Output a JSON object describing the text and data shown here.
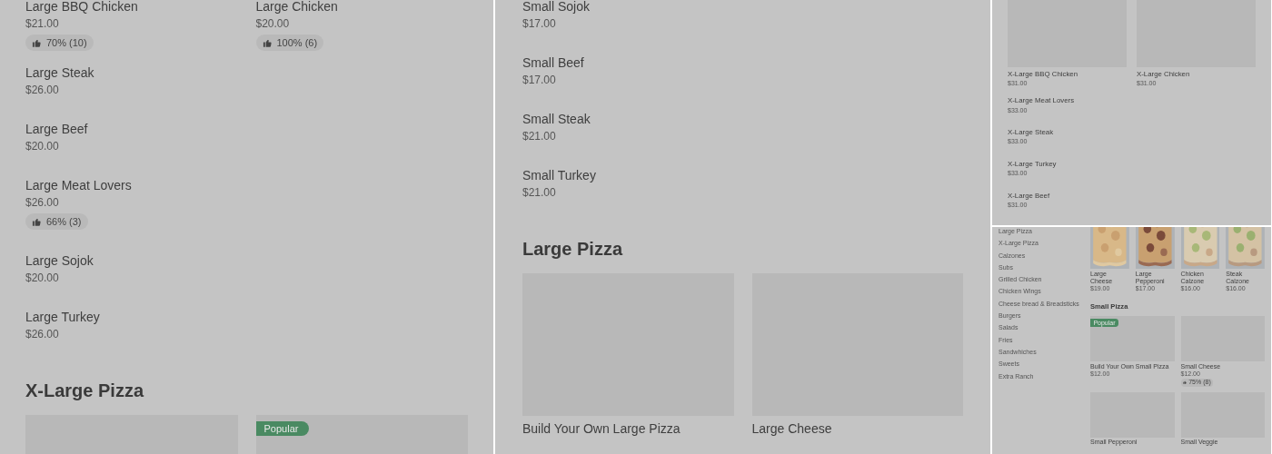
{
  "panels": [
    {
      "blocks": [
        {
          "kind": "text_cards",
          "cards": [
            {
              "name": "Large BBQ Chicken",
              "price": "$21.00",
              "rating": "70% (10)"
            },
            {
              "name": "Large Chicken",
              "price": "$20.00",
              "rating": "100% (6)"
            }
          ]
        },
        {
          "kind": "item",
          "name": "Large Steak",
          "price": "$26.00"
        },
        {
          "kind": "item",
          "name": "Large Beef",
          "price": "$20.00"
        },
        {
          "kind": "item",
          "name": "Large Meat Lovers",
          "price": "$26.00",
          "rating": "66% (3)"
        },
        {
          "kind": "item",
          "name": "Large Sojok",
          "price": "$20.00"
        },
        {
          "kind": "item",
          "name": "Large Turkey",
          "price": "$26.00"
        },
        {
          "kind": "heading",
          "text": "X-Large Pizza"
        },
        {
          "kind": "cards",
          "cards": [
            {
              "popular": false
            },
            {
              "popular": true,
              "badge": "Popular"
            }
          ]
        }
      ]
    },
    {
      "blocks": [
        {
          "kind": "item",
          "name": "Small Sojok",
          "price": "$17.00"
        },
        {
          "kind": "item",
          "name": "Small Beef",
          "price": "$17.00"
        },
        {
          "kind": "item",
          "name": "Small Steak",
          "price": "$21.00"
        },
        {
          "kind": "item",
          "name": "Small Turkey",
          "price": "$21.00"
        },
        {
          "kind": "heading",
          "text": "Large Pizza"
        },
        {
          "kind": "cards",
          "cards": [
            {
              "name": "Build Your Own Large Pizza"
            },
            {
              "name": "Large Cheese"
            }
          ]
        }
      ]
    },
    {
      "blocks": [
        {
          "kind": "cards",
          "cards": [
            {
              "name": "X-Large BBQ Chicken",
              "price": "$31.00"
            },
            {
              "name": "X-Large Chicken",
              "price": "$31.00"
            }
          ]
        },
        {
          "kind": "item",
          "name": "X-Large Meat Lovers",
          "price": "$33.00"
        },
        {
          "kind": "item",
          "name": "X-Large Steak",
          "price": "$33.00"
        },
        {
          "kind": "item",
          "name": "X-Large Turkey",
          "price": "$33.00"
        },
        {
          "kind": "item",
          "name": "X-Large Beef",
          "price": "$31.00"
        }
      ]
    },
    {
      "sidebar": [
        "Large Pizza",
        "X-Large Pizza",
        "Calzones",
        "Subs",
        "Grilled Chicken",
        "Chicken Wings",
        "Cheese bread & Breadsticks",
        "Burgers",
        "Salads",
        "Fries",
        "Sandwhiches",
        "Sweets",
        "Extra Ranch"
      ],
      "blocks": [
        {
          "kind": "photo_cards",
          "cards": [
            {
              "name": "Large Cheese",
              "price": "$19.00"
            },
            {
              "name": "Large Pepperoni",
              "price": "$17.00"
            },
            {
              "name": "Chicken Calzone",
              "price": "$16.00"
            },
            {
              "name": "Steak Calzone",
              "price": "$16.00"
            }
          ]
        },
        {
          "kind": "heading",
          "text": "Small Pizza"
        },
        {
          "kind": "cards",
          "cards": [
            {
              "popular": true,
              "badge": "Popular",
              "name": "Build Your Own Small Pizza",
              "price": "$12.00"
            },
            {
              "popular": false,
              "name": "Small Cheese",
              "price": "$12.00",
              "rating": "75% (8)"
            }
          ]
        },
        {
          "kind": "cards",
          "cards": [
            {
              "name": "Small Pepperoni"
            },
            {
              "name": "Small Veggie"
            }
          ]
        }
      ]
    }
  ]
}
